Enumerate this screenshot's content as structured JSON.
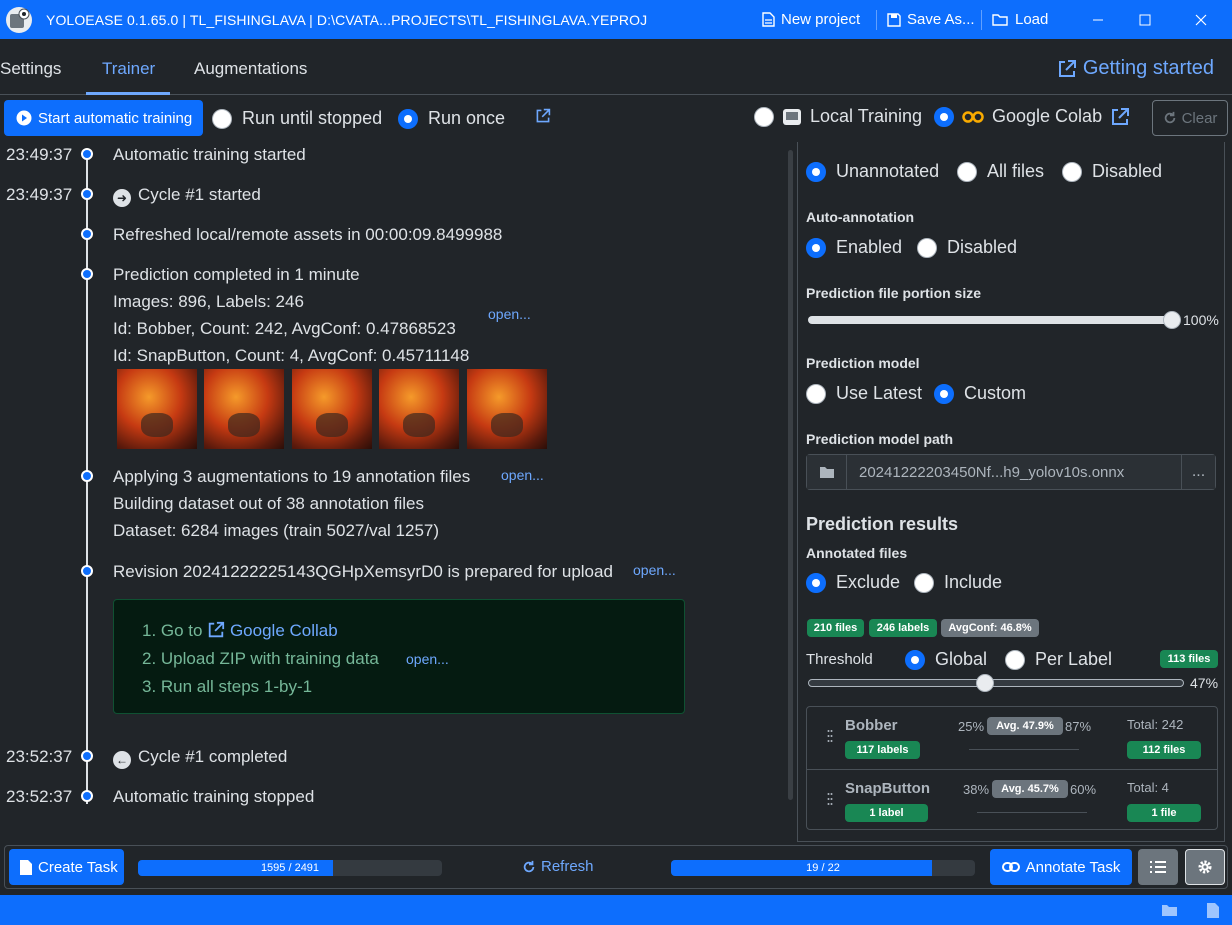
{
  "window": {
    "title": "YOLOEASE 0.1.65.0 | TL_FISHINGLAVA | D:\\CVATA...PROJECTS\\TL_FISHINGLAVA.YEPROJ",
    "new_project": "New project",
    "save_as": "Save As...",
    "load": "Load"
  },
  "tabs": {
    "settings": "Settings",
    "trainer": "Trainer",
    "augmentations": "Augmentations",
    "getting_started": "Getting started"
  },
  "toolbar": {
    "start_training": "Start automatic training",
    "run_until_stopped": "Run until stopped",
    "run_once": "Run once",
    "local_training": "Local Training",
    "google_colab": "Google Colab",
    "clear": "Clear"
  },
  "log": {
    "t1": "23:49:37",
    "m1": "Automatic training started",
    "t2": "23:49:37",
    "m2": "Cycle #1 started",
    "m3": "Refreshed local/remote assets in 00:00:09.8499988",
    "m4a": "Prediction completed in 1 minute",
    "m4b": "Images: 896, Labels: 246",
    "m4c": "Id: Bobber, Count: 242, AvgConf: 0.47868523",
    "m4d": "Id: SnapButton, Count: 4, AvgConf: 0.45711148",
    "open": "open...",
    "m5a": "Applying 3 augmentations to 19 annotation files",
    "m5b": "Building dataset out of 38 annotation files",
    "m5c": "Dataset: 6284 images (train 5027/val 1257)",
    "m6": "Revision 20241222225143QGHpXemsyrD0 is prepared for upload",
    "step1_prefix": "1. Go to",
    "step1_link": "Google Collab",
    "step2": "2. Upload ZIP with training data",
    "step3": "3. Run all steps 1-by-1",
    "t7": "23:52:37",
    "m7": "Cycle #1 completed",
    "t8": "23:52:37",
    "m8": "Automatic training stopped"
  },
  "panel": {
    "strategy_options": [
      "Unannotated",
      "All files",
      "Disabled"
    ],
    "auto_annotation_title": "Auto-annotation",
    "auto_annotation_options": [
      "Enabled",
      "Disabled"
    ],
    "portion_title": "Prediction file portion size",
    "portion_value": "100%",
    "portion_fraction": 1.0,
    "model_title": "Prediction model",
    "model_options": [
      "Use Latest",
      "Custom"
    ],
    "model_path_title": "Prediction model path",
    "model_path": "20241222203450Nf...h9_yolov10s.onnx",
    "more": "...",
    "results_title": "Prediction results",
    "annotated_files_title": "Annotated files",
    "annotated_options": [
      "Exclude",
      "Include"
    ],
    "badge_files": "210 files",
    "badge_labels": "246 labels",
    "badge_avgconf": "AvgConf: 46.8%",
    "threshold_label": "Threshold",
    "threshold_options": [
      "Global",
      "Per Label"
    ],
    "threshold_files": "113 files",
    "threshold_value": "47%",
    "threshold_fraction": 0.47,
    "labels": [
      {
        "name": "Bobber",
        "min": "25%",
        "avg": "Avg. 47.9%",
        "max": "87%",
        "count": "117 labels",
        "total": "Total: 242",
        "files": "112 files"
      },
      {
        "name": "SnapButton",
        "min": "38%",
        "avg": "Avg. 45.7%",
        "max": "60%",
        "count": "1 label",
        "total": "Total: 4",
        "files": "1 file"
      }
    ]
  },
  "bottom": {
    "create_task": "Create Task",
    "progress1": "1595 / 2491",
    "progress1_value": 0.64,
    "refresh": "Refresh",
    "progress2": "19 / 22",
    "progress2_value": 0.86,
    "annotate_task": "Annotate Task"
  }
}
